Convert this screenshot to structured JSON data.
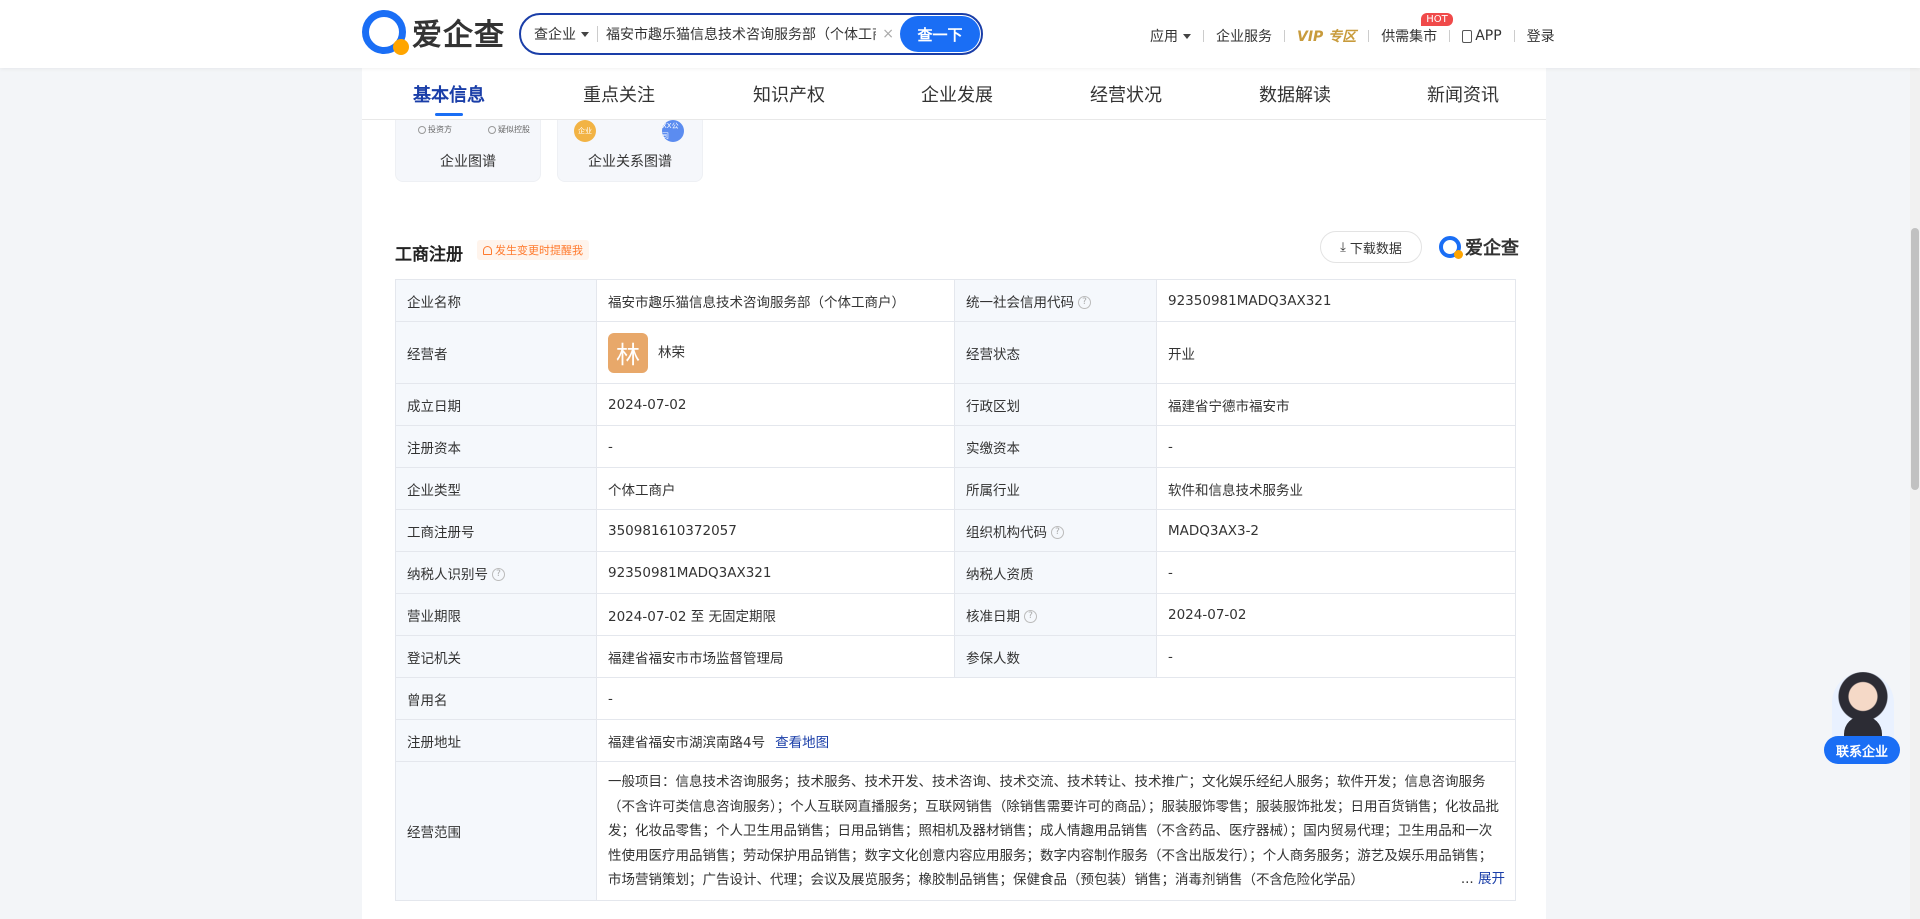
{
  "header": {
    "logo_text": "爱企查",
    "search_type": "查企业",
    "search_value": "福安市趣乐猫信息技术咨询服务部（个体工商户）",
    "search_clear": "×",
    "search_button": "查一下",
    "nav": {
      "apps": "应用",
      "enterprise_service": "企业服务",
      "vip": "VIP 专区",
      "market": "供需集市",
      "hot_badge": "HOT",
      "app": "APP",
      "login": "登录"
    }
  },
  "tabs": [
    "基本信息",
    "重点关注",
    "知识产权",
    "企业发展",
    "经营状况",
    "数据解读",
    "新闻资讯"
  ],
  "graph_cards": {
    "card1": {
      "label": "企业图谱",
      "mini1": "投资方",
      "mini2": "疑似控股"
    },
    "card2": {
      "label": "企业关系图谱",
      "node1": "企业",
      "node2": "XX公司"
    }
  },
  "section": {
    "title": "工商注册",
    "remind": "发生变更时提醒我",
    "download": "下载数据",
    "brand": "爱企查"
  },
  "registration": {
    "name_label": "企业名称",
    "name": "福安市趣乐猫信息技术咨询服务部（个体工商户）",
    "credit_code_label": "统一社会信用代码",
    "credit_code": "92350981MADQ3AX321",
    "operator_label": "经营者",
    "operator_avatar": "林",
    "operator": "林荣",
    "status_label": "经营状态",
    "status": "开业",
    "founded_label": "成立日期",
    "founded": "2024-07-02",
    "region_label": "行政区划",
    "region": "福建省宁德市福安市",
    "capital_label": "注册资本",
    "capital": "-",
    "paid_capital_label": "实缴资本",
    "paid_capital": "-",
    "type_label": "企业类型",
    "type": "个体工商户",
    "industry_label": "所属行业",
    "industry": "软件和信息技术服务业",
    "reg_no_label": "工商注册号",
    "reg_no": "350981610372057",
    "org_code_label": "组织机构代码",
    "org_code": "MADQ3AX3-2",
    "taxpayer_id_label": "纳税人识别号",
    "taxpayer_id": "92350981MADQ3AX321",
    "taxpayer_qual_label": "纳税人资质",
    "taxpayer_qual": "-",
    "term_label": "营业期限",
    "term": "2024-07-02 至 无固定期限",
    "approval_label": "核准日期",
    "approval": "2024-07-02",
    "authority_label": "登记机关",
    "authority": "福建省福安市市场监督管理局",
    "insured_label": "参保人数",
    "insured": "-",
    "former_name_label": "曾用名",
    "former_name": "-",
    "address_label": "注册地址",
    "address": "福建省福安市湖滨南路4号",
    "map_link": "查看地图",
    "scope_label": "经营范围",
    "scope": "一般项目：信息技术咨询服务；技术服务、技术开发、技术咨询、技术交流、技术转让、技术推广；文化娱乐经纪人服务；软件开发；信息咨询服务（不含许可类信息咨询服务）；个人互联网直播服务；互联网销售（除销售需要许可的商品）；服装服饰零售；服装服饰批发；日用百货销售；化妆品批发；化妆品零售；个人卫生用品销售；日用品销售；照相机及器材销售；成人情趣用品销售（不含药品、医疗器械）；国内贸易代理；卫生用品和一次性使用医疗用品销售；劳动保护用品销售；数字文化创意内容应用服务；数字内容制作服务（不含出版发行）；个人商务服务；游艺及娱乐用品销售；市场营销策划；广告设计、代理；会议及展览服务；橡胶制品销售；保健食品（预包装）销售；消毒剂销售（不含危险化学品）",
    "expand_ellipsis": "...",
    "expand": "展开"
  },
  "float": {
    "contact": "联系企业"
  }
}
